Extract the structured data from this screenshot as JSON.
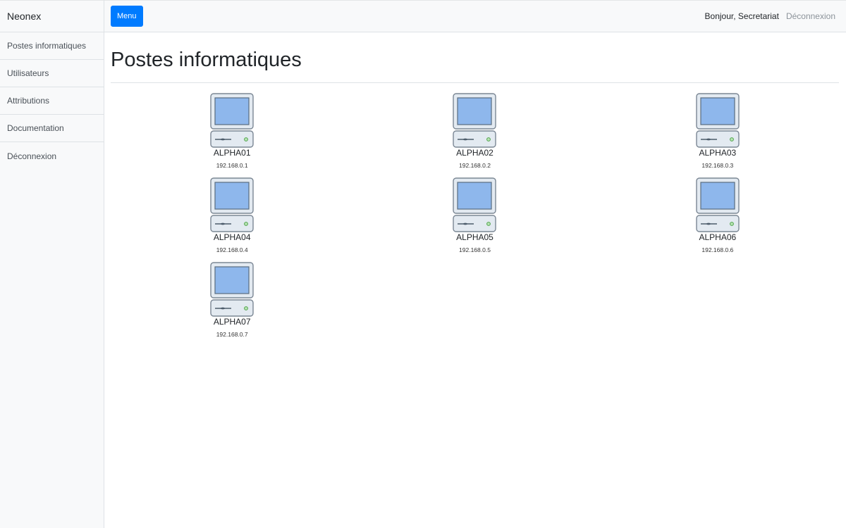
{
  "sidebar": {
    "brand": "Neonex",
    "items": [
      {
        "label": "Postes informatiques"
      },
      {
        "label": "Utilisateurs"
      },
      {
        "label": "Attributions"
      },
      {
        "label": "Documentation"
      },
      {
        "label": "Déconnexion"
      }
    ]
  },
  "topbar": {
    "menu_label": "Menu",
    "greeting": "Bonjour, Secretariat",
    "logout": "Déconnexion",
    "accent": "#007bff"
  },
  "main": {
    "title": "Postes informatiques",
    "computers": [
      {
        "name": "ALPHA01",
        "ip": "192.168.0.1",
        "icon": "computer-icon"
      },
      {
        "name": "ALPHA02",
        "ip": "192.168.0.2",
        "icon": "computer-icon"
      },
      {
        "name": "ALPHA03",
        "ip": "192.168.0.3",
        "icon": "computer-icon"
      },
      {
        "name": "ALPHA04",
        "ip": "192.168.0.4",
        "icon": "computer-icon"
      },
      {
        "name": "ALPHA05",
        "ip": "192.168.0.5",
        "icon": "computer-icon"
      },
      {
        "name": "ALPHA06",
        "ip": "192.168.0.6",
        "icon": "computer-icon"
      },
      {
        "name": "ALPHA07",
        "ip": "192.168.0.7",
        "icon": "computer-icon"
      }
    ]
  }
}
